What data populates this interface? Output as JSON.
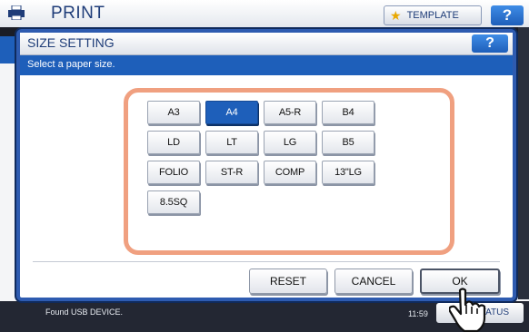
{
  "background": {
    "title": "PRINT",
    "template_button": "TEMPLATE",
    "help_button": "?",
    "footer_message": "Found USB DEVICE.",
    "clock": "11:59",
    "status_button": "STATUS"
  },
  "dialog": {
    "title": "SIZE SETTING",
    "help_button": "?",
    "instruction": "Select a paper size.",
    "paper_sizes": [
      {
        "label": "A3",
        "selected": false
      },
      {
        "label": "A4",
        "selected": true
      },
      {
        "label": "A5-R",
        "selected": false
      },
      {
        "label": "B4",
        "selected": false
      },
      {
        "label": "LD",
        "selected": false
      },
      {
        "label": "LT",
        "selected": false
      },
      {
        "label": "LG",
        "selected": false
      },
      {
        "label": "B5",
        "selected": false
      },
      {
        "label": "FOLIO",
        "selected": false
      },
      {
        "label": "ST-R",
        "selected": false
      },
      {
        "label": "COMP",
        "selected": false
      },
      {
        "label": "13\"LG",
        "selected": false
      },
      {
        "label": "8.5SQ",
        "selected": false
      }
    ],
    "buttons": {
      "reset": "RESET",
      "cancel": "CANCEL",
      "ok": "OK"
    }
  },
  "colors": {
    "accent_blue": "#1e5fba",
    "panel_border": "#f0a080"
  }
}
